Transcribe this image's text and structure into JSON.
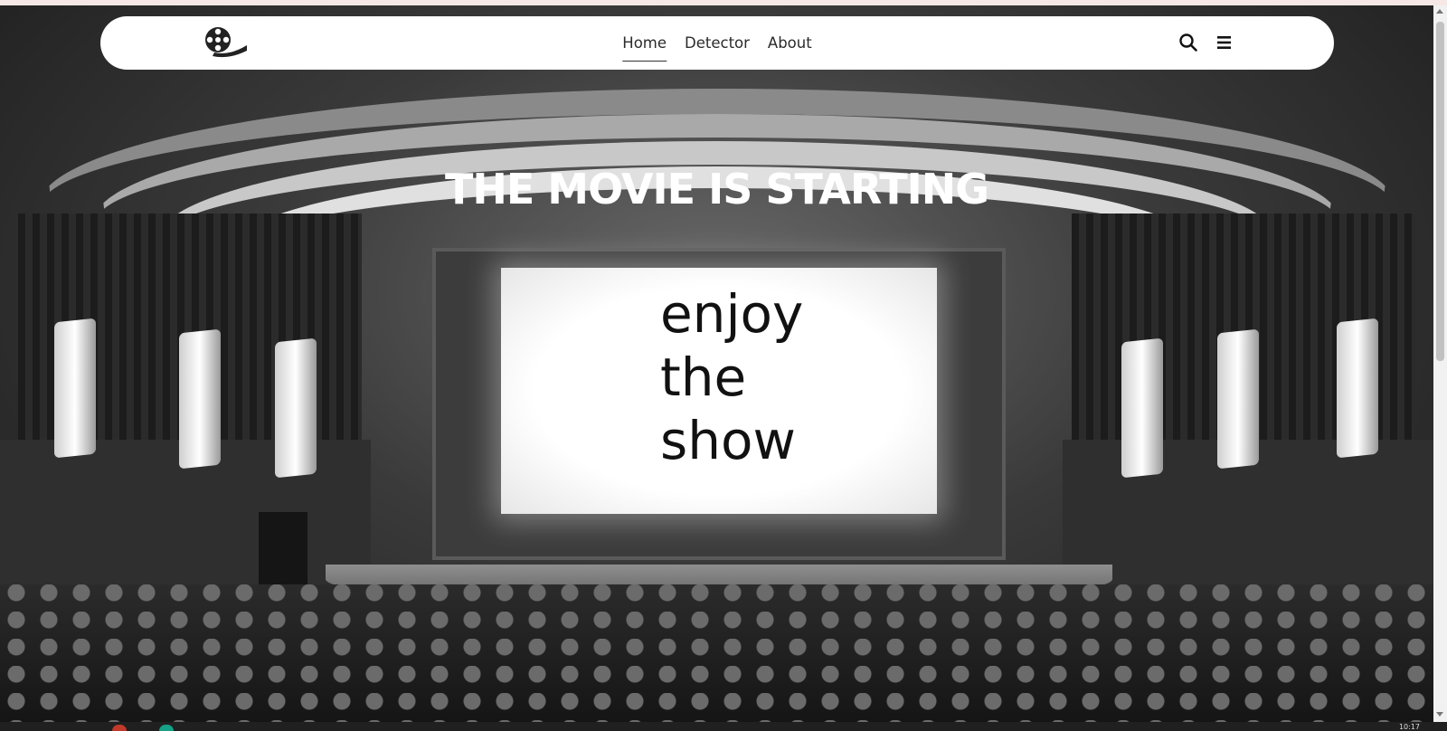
{
  "nav": {
    "logo_icon": "film-reel-icon",
    "links": [
      {
        "label": "Home",
        "active": true
      },
      {
        "label": "Detector",
        "active": false
      },
      {
        "label": "About",
        "active": false
      }
    ],
    "search_icon": "search-icon",
    "menu_icon": "hamburger-menu-icon"
  },
  "hero": {
    "title": "THE MOVIE IS STARTING",
    "lines": [
      "enjoy",
      "the",
      "show"
    ],
    "background": "black-and-white cinema theater"
  },
  "taskbar": {
    "clock": "10:17"
  },
  "colors": {
    "navbar_bg": "#ffffff",
    "title_text": "#ffffff",
    "screen_text": "#111111"
  }
}
